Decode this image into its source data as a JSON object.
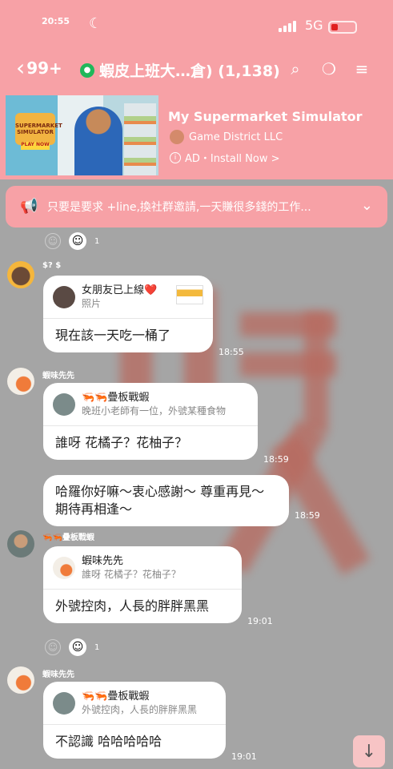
{
  "status_bar": {
    "time": "20:55",
    "network": "5G"
  },
  "nav": {
    "back_count": "99+",
    "title": "蝦皮上班大…倉) (1,138)"
  },
  "ad": {
    "title": "My Supermarket Simulator",
    "developer": "Game District LLC",
    "cta": "AD・Install Now >",
    "image_logo": "SUPERMARKET SIMULATOR",
    "image_button": "PLAY NOW"
  },
  "notice": {
    "text": "只要是要求 +line,換社群邀請,一天賺很多錢的工作..."
  },
  "messages": [
    {
      "sender": "$? $",
      "quote_name": "女朋友已上線❤️",
      "quote_text": "照片",
      "text": "現在該一天吃一桶了",
      "time": "18:55"
    },
    {
      "sender": "蝦味先先",
      "quote_name": "🦐🦐疊板戰蝦",
      "quote_text": "晚班小老師有一位，外號某種食物",
      "text": "誰呀 花橘子？花柚子？",
      "time": "18:59"
    },
    {
      "text": "哈羅你好嘛～衷心感謝～ 尊重再見～期待再相逢～",
      "time": "18:59"
    },
    {
      "sender": "🦐🦐疊板戰蝦",
      "quote_name": "蝦味先先",
      "quote_text": "誰呀 花橘子？花柚子？",
      "text": "外號控肉，人長的胖胖黑黑",
      "time": "19:01"
    },
    {
      "sender": "蝦味先先",
      "quote_name": "🦐🦐疊板戰蝦",
      "quote_text": "外號控肉，人長的胖胖黑黑",
      "text": "不認識 哈哈哈哈哈",
      "time": "19:01"
    }
  ],
  "reactions": [
    {
      "count": "1"
    },
    {
      "count": "1"
    }
  ]
}
